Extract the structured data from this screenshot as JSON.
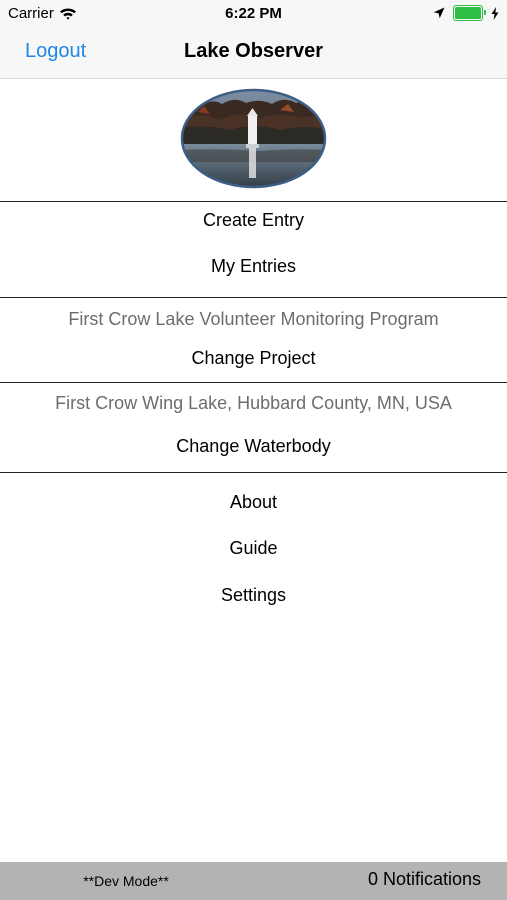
{
  "status_bar": {
    "carrier": "Carrier",
    "time": "6:22 PM",
    "battery_level": 1.0,
    "battery_color": "#2fbf45",
    "icons": [
      "wifi-icon",
      "location-arrow-icon",
      "battery-icon",
      "charging-bolt-icon"
    ]
  },
  "nav": {
    "left_button": "Logout",
    "title": "Lake Observer",
    "accent_color": "#1e88e5"
  },
  "menu": {
    "entries": [
      "Create Entry",
      "My Entries"
    ],
    "project_name": "First Crow Lake Volunteer Monitoring Program",
    "change_project": "Change Project",
    "waterbody_name": "First Crow Wing Lake, Hubbard County, MN, USA",
    "change_waterbody": "Change Waterbody",
    "misc": [
      "About",
      "Guide",
      "Settings"
    ]
  },
  "footer": {
    "dev_mode": "**Dev Mode**",
    "notifications": "0 Notifications"
  }
}
